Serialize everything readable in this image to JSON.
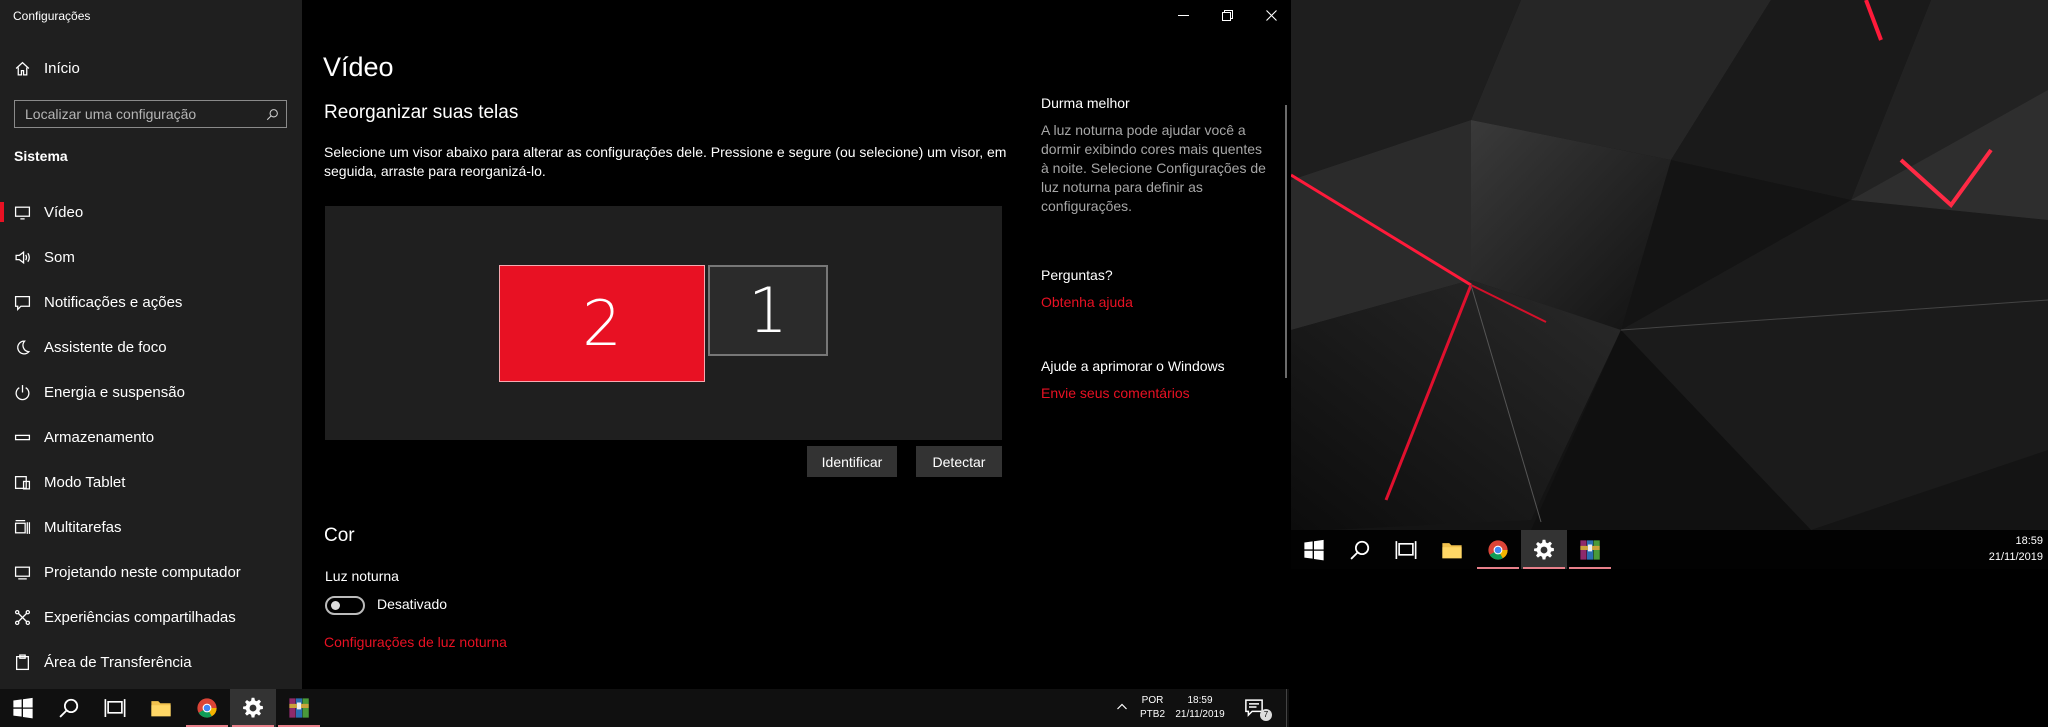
{
  "window": {
    "title": "Configurações",
    "controls": {
      "minimize": "minimize",
      "restore": "restore",
      "close": "close"
    }
  },
  "sidebar": {
    "home_label": "Início",
    "search_placeholder": "Localizar uma configuração",
    "section": "Sistema",
    "items": [
      {
        "label": "Vídeo",
        "icon": "monitor-icon",
        "active": true
      },
      {
        "label": "Som",
        "icon": "speaker-icon"
      },
      {
        "label": "Notificações e ações",
        "icon": "notification-icon"
      },
      {
        "label": "Assistente de foco",
        "icon": "moon-icon"
      },
      {
        "label": "Energia e suspensão",
        "icon": "power-icon"
      },
      {
        "label": "Armazenamento",
        "icon": "storage-icon"
      },
      {
        "label": "Modo Tablet",
        "icon": "tablet-icon"
      },
      {
        "label": "Multitarefas",
        "icon": "multitask-icon"
      },
      {
        "label": "Projetando neste computador",
        "icon": "project-icon"
      },
      {
        "label": "Experiências compartilhadas",
        "icon": "share-icon"
      },
      {
        "label": "Área de Transferência",
        "icon": "clipboard-icon"
      }
    ]
  },
  "main": {
    "page_title": "Vídeo",
    "rearrange_title": "Reorganizar suas telas",
    "rearrange_desc": "Selecione um visor abaixo para alterar as configurações dele. Pressione e segure (ou selecione) um visor, em seguida, arraste para reorganizá-lo.",
    "monitors": [
      {
        "number": "2",
        "selected": true
      },
      {
        "number": "1",
        "selected": false
      }
    ],
    "identify_label": "Identificar",
    "detect_label": "Detectar",
    "color_title": "Cor",
    "night_light_label": "Luz noturna",
    "night_light_state": "Desativado",
    "night_light_link": "Configurações de luz noturna"
  },
  "right_panel": {
    "sleep_title": "Durma melhor",
    "sleep_text": "A luz noturna pode ajudar você a dormir exibindo cores mais quentes à noite. Selecione Configurações de luz noturna para definir as configurações.",
    "questions_title": "Perguntas?",
    "help_link": "Obtenha ajuda",
    "improve_title": "Ajude a aprimorar o Windows",
    "feedback_link": "Envie seus comentários"
  },
  "taskbar": {
    "language": "POR",
    "keyboard": "PTB2",
    "time": "18:59",
    "date": "21/11/2019",
    "notification_count": "7"
  },
  "desktop_taskbar": {
    "time": "18:59",
    "date": "21/11/2019"
  },
  "colors": {
    "accent": "#e81123",
    "sidebar_bg": "#1f1f1f",
    "content_bg": "#000000"
  }
}
